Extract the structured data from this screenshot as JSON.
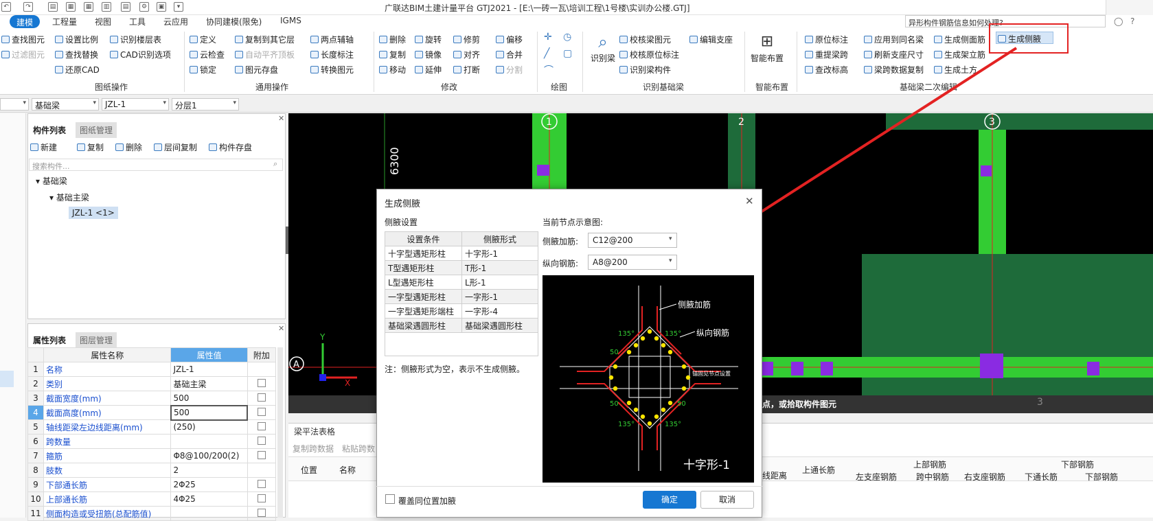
{
  "app": {
    "title": "广联达BIM土建计量平台 GTJ2021 - [E:\\一砖一瓦\\培训工程\\1号楼\\实训办公楼.GTJ]"
  },
  "menu": {
    "items": [
      "建模",
      "工程量",
      "视图",
      "工具",
      "云应用",
      "协同建模(限免)",
      "IGMS"
    ],
    "help_search": "异形构件钢筋信息如何处理?"
  },
  "ribbon": {
    "col1": [
      "查找图元",
      "过滤图元"
    ],
    "col2": [
      "设置比例",
      "查找替换",
      "还原CAD"
    ],
    "col3": [
      "识别楼层表",
      "CAD识别选项"
    ],
    "col4": [
      "定义",
      "云检查",
      "锁定"
    ],
    "col5": [
      "复制到其它层",
      "自动平齐顶板",
      "图元存盘"
    ],
    "col6": [
      "两点辅轴",
      "长度标注",
      "转换图元"
    ],
    "col7": [
      "删除",
      "复制",
      "移动"
    ],
    "col8": [
      "旋转",
      "镜像",
      "延伸"
    ],
    "col9": [
      "修剪",
      "对齐",
      "打断"
    ],
    "col10": [
      "偏移",
      "合并",
      "分割"
    ],
    "recognize_beam": "识别梁",
    "col11": [
      "校核梁图元",
      "校核原位标注",
      "识别梁构件"
    ],
    "col12": [
      "编辑支座"
    ],
    "smart_layout": "智能布置",
    "col13": [
      "原位标注",
      "重提梁跨",
      "查改标高"
    ],
    "col14": [
      "应用到同名梁",
      "刷新支座尺寸",
      "梁跨数据复制"
    ],
    "col15": [
      "生成侧面筋",
      "生成架立筋",
      "生成土方"
    ],
    "generate_haunch": "生成侧腋",
    "groups": [
      "图纸操作",
      "通用操作",
      "修改",
      "绘图",
      "识别基础梁",
      "智能布置",
      "基础梁二次编辑"
    ]
  },
  "filters": {
    "f1": "基础梁",
    "f2": "JZL-1",
    "f3": "分层1"
  },
  "component_panel": {
    "tabs": [
      "构件列表",
      "图纸管理"
    ],
    "actions": [
      "新建",
      "复制",
      "删除",
      "层间复制",
      "构件存盘"
    ],
    "search_placeholder": "搜索构件...",
    "tree": {
      "root": "基础梁",
      "child": "基础主梁",
      "leaf": "JZL-1 <1>"
    }
  },
  "property_panel": {
    "tabs": [
      "属性列表",
      "图层管理"
    ],
    "headers": [
      "属性名称",
      "属性值",
      "附加"
    ],
    "rows": [
      {
        "no": "1",
        "name": "名称",
        "value": "JZL-1",
        "cb": false
      },
      {
        "no": "2",
        "name": "类别",
        "value": "基础主梁",
        "cb": true
      },
      {
        "no": "3",
        "name": "截面宽度(mm)",
        "value": "500",
        "cb": true
      },
      {
        "no": "4",
        "name": "截面高度(mm)",
        "value": "500",
        "cb": true
      },
      {
        "no": "5",
        "name": "轴线距梁左边线距离(mm)",
        "value": "(250)",
        "cb": true
      },
      {
        "no": "6",
        "name": "跨数量",
        "value": "",
        "cb": true
      },
      {
        "no": "7",
        "name": "箍筋",
        "value": "Φ8@100/200(2)",
        "cb": true
      },
      {
        "no": "8",
        "name": "肢数",
        "value": "2",
        "cb": false
      },
      {
        "no": "9",
        "name": "下部通长筋",
        "value": "2Φ25",
        "cb": true
      },
      {
        "no": "10",
        "name": "上部通长筋",
        "value": "4Φ25",
        "cb": true
      },
      {
        "no": "11",
        "name": "侧面构造或受扭筋(总配筋值)",
        "value": "",
        "cb": true
      }
    ]
  },
  "canvas": {
    "axis_labels": [
      "1",
      "2",
      "3"
    ],
    "dimension": "6300",
    "row_label": "A",
    "axis_x": "X",
    "axis_y": "Y",
    "status_text": "点，或拾取构件图元",
    "bottom_axis": "3"
  },
  "lower_panel": {
    "title": "梁平法表格",
    "actions": [
      "复制跨数据",
      "粘贴跨数"
    ],
    "col_headers": [
      "位置",
      "名称"
    ],
    "right_headers": [
      "线距离",
      "上通长筋",
      "上部钢筋",
      "左支座钢筋",
      "跨中钢筋",
      "右支座钢筋",
      "下部钢筋",
      "下通长筋",
      "下部钢筋"
    ]
  },
  "dialog": {
    "title": "生成侧腋",
    "section_label": "侧腋设置",
    "table_headers": [
      "设置条件",
      "侧腋形式"
    ],
    "rows": [
      [
        "十字型遇矩形柱",
        "十字形-1"
      ],
      [
        "T型遇矩形柱",
        "T形-1"
      ],
      [
        "L型遇矩形柱",
        "L形-1"
      ],
      [
        "一字型遇矩形柱",
        "一字形-1"
      ],
      [
        "一字型遇矩形端柱",
        "一字形-4"
      ],
      [
        "基础梁遇圆形柱",
        "基础梁遇圆形柱"
      ]
    ],
    "note": "注：侧腋形式为空，表示不生成侧腋。",
    "diagram_label": "当前节点示意图:",
    "field1_label": "侧腋加筋:",
    "field1_value": "C12@200",
    "field2_label": "纵向钢筋:",
    "field2_value": "A8@200",
    "diagram": {
      "haunch_bar": "侧腋加筋",
      "long_bar": "纵向钢筋",
      "note_right": "锚固见节点设置",
      "shape_name": "十字形-1",
      "angle1": "135°",
      "angle2": "135°",
      "angle3": "135°",
      "angle4": "135°",
      "dim": "50"
    },
    "checkbox_label": "覆盖同位置加腋",
    "ok": "确定",
    "cancel": "取消"
  },
  "colors": {
    "accent": "#1677d2",
    "beam_green": "#33cc33",
    "dark_green": "#1e6b3a",
    "purple": "#8a2be2",
    "arrow_red": "#e32222"
  }
}
